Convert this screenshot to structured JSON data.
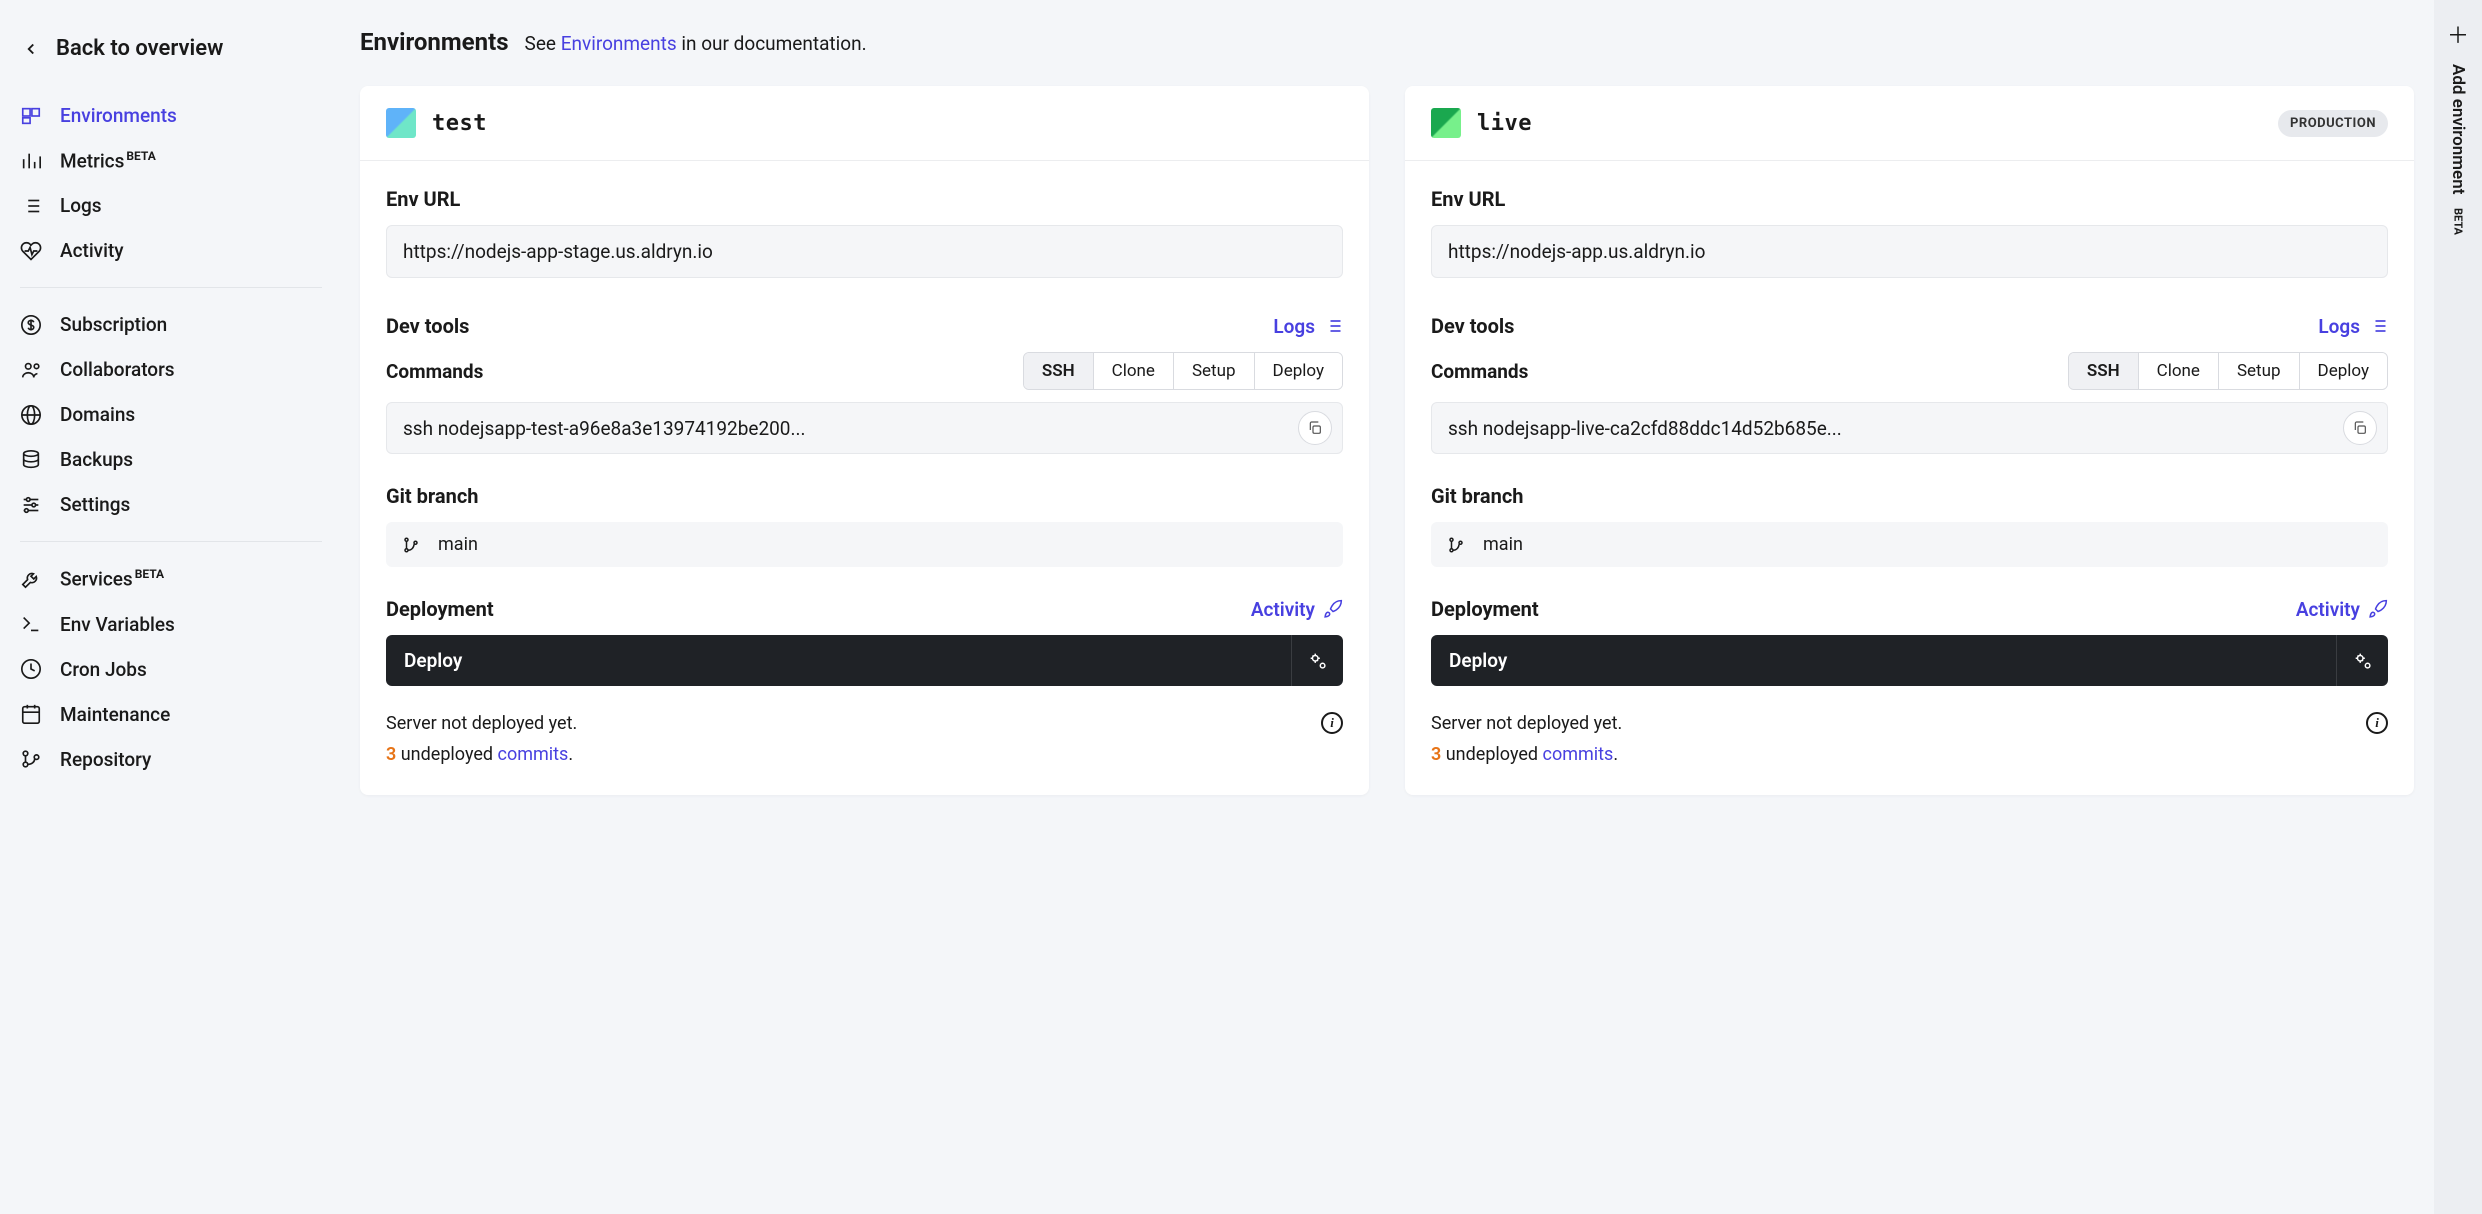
{
  "back_label": "Back to overview",
  "nav": {
    "items": [
      {
        "label": "Environments",
        "icon": "environments",
        "active": true
      },
      {
        "label": "Metrics",
        "icon": "metrics",
        "beta": true
      },
      {
        "label": "Logs",
        "icon": "logs"
      },
      {
        "label": "Activity",
        "icon": "activity"
      }
    ],
    "items2": [
      {
        "label": "Subscription",
        "icon": "subscription"
      },
      {
        "label": "Collaborators",
        "icon": "collaborators"
      },
      {
        "label": "Domains",
        "icon": "domains"
      },
      {
        "label": "Backups",
        "icon": "backups"
      },
      {
        "label": "Settings",
        "icon": "settings"
      }
    ],
    "items3": [
      {
        "label": "Services",
        "icon": "services",
        "beta": true
      },
      {
        "label": "Env Variables",
        "icon": "envvars"
      },
      {
        "label": "Cron Jobs",
        "icon": "cron"
      },
      {
        "label": "Maintenance",
        "icon": "maintenance"
      },
      {
        "label": "Repository",
        "icon": "repository"
      }
    ],
    "beta_label": "BETA"
  },
  "header": {
    "title": "Environments",
    "pre": "See ",
    "link": "Environments",
    "post": " in our documentation."
  },
  "labels": {
    "env_url": "Env URL",
    "dev_tools": "Dev tools",
    "logs": "Logs",
    "commands": "Commands",
    "git_branch": "Git branch",
    "deployment": "Deployment",
    "activity": "Activity",
    "deploy": "Deploy",
    "undeployed_word": " undeployed ",
    "commits_word": "commits",
    "period": "."
  },
  "cmd_tabs": [
    "SSH",
    "Clone",
    "Setup",
    "Deploy"
  ],
  "environments": [
    {
      "name": "test",
      "swatch": "test",
      "badge": null,
      "url": "https://nodejs-app-stage.us.aldryn.io",
      "ssh": "ssh nodejsapp-test-a96e8a3e13974192be200...",
      "branch": "main",
      "status": "Server not deployed yet.",
      "undeployed_count": "3"
    },
    {
      "name": "live",
      "swatch": "live",
      "badge": "PRODUCTION",
      "url": "https://nodejs-app.us.aldryn.io",
      "ssh": "ssh nodejsapp-live-ca2cfd88ddc14d52b685e...",
      "branch": "main",
      "status": "Server not deployed yet.",
      "undeployed_count": "3"
    }
  ],
  "right_rail": {
    "label": "Add environment",
    "beta": "BETA"
  }
}
